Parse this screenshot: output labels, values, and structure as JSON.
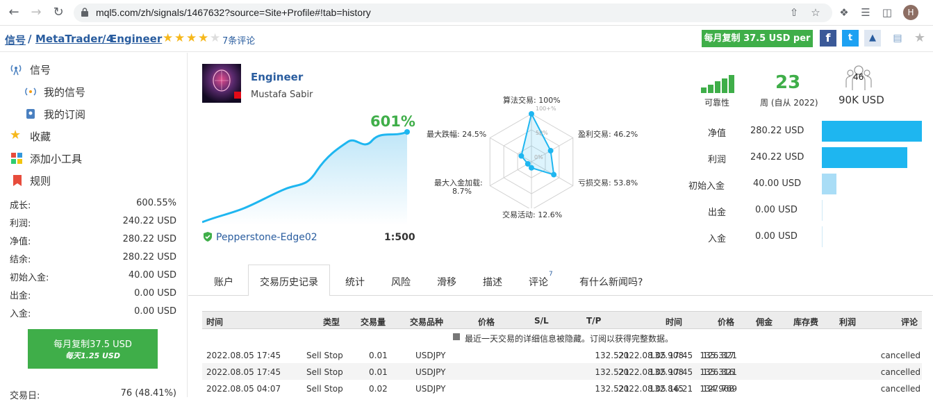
{
  "browser": {
    "url": "mql5.com/zh/signals/1467632?source=Site+Profile#!tab=history",
    "avatar_letter": "H"
  },
  "breadcrumb": {
    "items": [
      "信号",
      "MetaTrader 4",
      "Engineer"
    ],
    "separator": "/",
    "rating": 3.5,
    "reviews": "7条评论"
  },
  "header": {
    "copy_button": "每月复制 37.5 USD per"
  },
  "sidebar": {
    "nav": [
      {
        "label": "信号",
        "icon": "signal-icon"
      },
      {
        "label": "我的信号",
        "icon": "broadcast-icon"
      },
      {
        "label": "我的订阅",
        "icon": "subscription-icon"
      },
      {
        "label": "收藏",
        "icon": "star-icon"
      },
      {
        "label": "添加小工具",
        "icon": "widget-icon"
      },
      {
        "label": "规则",
        "icon": "bookmark-icon"
      }
    ],
    "stats": [
      {
        "label": "成长:",
        "value": "600.55%"
      },
      {
        "label": "利润:",
        "value": "240.22 USD"
      },
      {
        "label": "净值:",
        "value": "280.22 USD"
      },
      {
        "label": "结余:",
        "value": "280.22 USD"
      },
      {
        "label": "初始入金:",
        "value": "40.00 USD"
      },
      {
        "label": "出金:",
        "value": "0.00 USD"
      },
      {
        "label": "入金:",
        "value": "0.00 USD"
      }
    ],
    "subscribe": {
      "line1": "每月复制37.5 USD",
      "line2": "每天1.25 USD"
    },
    "trading_days": {
      "label": "交易日:",
      "value": "76 (48.41%)"
    }
  },
  "profile": {
    "name": "Engineer",
    "author": "Mustafa Sabir",
    "growth": "601%",
    "broker": "Pepperstone-Edge02",
    "leverage": "1:500"
  },
  "radar": {
    "labels": [
      {
        "text": "算法交易: 100%",
        "value": 100
      },
      {
        "text": "盈利交易: 46.2%",
        "value": 46.2
      },
      {
        "text": "亏损交易: 53.8%",
        "value": 53.8
      },
      {
        "text": "交易活动: 12.6%",
        "value": 12.6
      },
      {
        "text": "最大入金加载:",
        "text2": "8.7%",
        "value": 8.7
      },
      {
        "text": "最大跌幅: 24.5%",
        "value": 24.5
      }
    ],
    "scale": [
      "100+%",
      "50%",
      "0%"
    ]
  },
  "summary": {
    "reliability_label": "可靠性",
    "weeks": "23",
    "weeks_label": "周 (自从 2022)",
    "subscribers": "46",
    "subscribers_funds": "90K USD"
  },
  "balance_bars": [
    {
      "label": "净值",
      "value": "280.22 USD",
      "amount": 280.22
    },
    {
      "label": "利润",
      "value": "240.22 USD",
      "amount": 240.22
    },
    {
      "label": "初始入金",
      "value": "40.00 USD",
      "amount": 40.0
    },
    {
      "label": "出金",
      "value": "0.00 USD",
      "amount": 0
    },
    {
      "label": "入金",
      "value": "0.00 USD",
      "amount": 0
    }
  ],
  "tabs": [
    {
      "label": "账户"
    },
    {
      "label": "交易历史记录",
      "active": true
    },
    {
      "label": "统计"
    },
    {
      "label": "风险"
    },
    {
      "label": "滑移"
    },
    {
      "label": "描述"
    },
    {
      "label": "评论",
      "badge": "7"
    },
    {
      "label": "有什么新闻吗?"
    }
  ],
  "table": {
    "headers": [
      "时间",
      "类型",
      "交易量",
      "交易品种",
      "价格",
      "S/L",
      "T/P",
      "时间",
      "价格",
      "佣金",
      "库存费",
      "利润",
      "评论"
    ],
    "notice": "最近一天交易的详细信息被隐藏。订阅以获得完整数据。",
    "rows": [
      [
        "2022.08.05 17:45",
        "Sell Stop",
        "0.01",
        "USDJPY",
        "132.521",
        "132.908",
        "126.321",
        "2022.08.05 17:45",
        "135.317",
        "",
        "",
        "",
        "cancelled"
      ],
      [
        "2022.08.05 17:45",
        "Sell Stop",
        "0.01",
        "USDJPY",
        "132.521",
        "132.908",
        "126.321",
        "2022.08.05 17:45",
        "135.316",
        "",
        "",
        "",
        "cancelled"
      ],
      [
        "2022.08.05 04:07",
        "Sell Stop",
        "0.02",
        "USDJPY",
        "132.521",
        "132.845",
        "127.769",
        "2022.08.05 16:21",
        "134.968",
        "",
        "",
        "",
        "cancelled"
      ]
    ]
  },
  "colors": {
    "brand_blue": "#2a5d9f",
    "green": "#3fae49",
    "bar_blue": "#1eb6f0",
    "bar_light": "#a9ddf6"
  }
}
